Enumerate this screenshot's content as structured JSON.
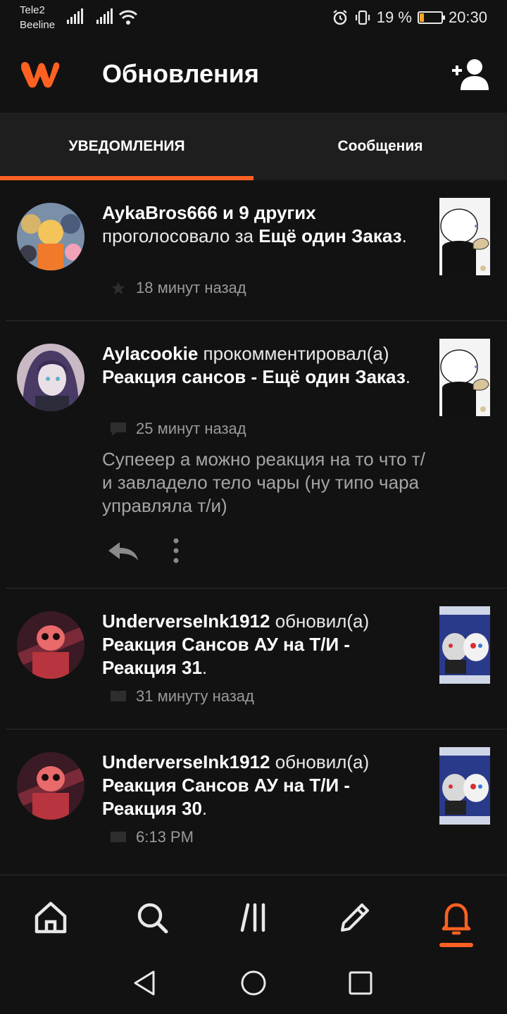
{
  "status_bar": {
    "carrier_1": "Tele2",
    "carrier_2": "Beeline",
    "battery": "19 %",
    "time": "20:30",
    "battery_level": 0.19
  },
  "header": {
    "title": "Обновления"
  },
  "tabs": [
    {
      "label": "УВЕДОМЛЕНИЯ",
      "active": true
    },
    {
      "label": "Сообщения",
      "active": false
    }
  ],
  "notifications": [
    {
      "user": "AykaBros666 и 9 других",
      "action": " проголосовало за ",
      "story": "Ещё один Заказ",
      "end": ".",
      "meta_icon": "star-icon",
      "time": "18 минут назад"
    },
    {
      "user": "Aylacookie",
      "action": " прокомментировал(а) ",
      "story": "Реакция сансов - Ещё один Заказ",
      "end": ".",
      "meta_icon": "comment-icon",
      "time": "25 минут назад",
      "comment": "Супееер а можно реакция на то что т/и завладело тело чары (ну типо чара управляла т/и)"
    },
    {
      "user": "UnderverseInk1912",
      "action": " обновил(а) ",
      "story": "Реакция Сансов АУ на Т/И - Реакция 31",
      "end": ".",
      "meta_icon": "book-icon",
      "time": "31 минуту назад"
    },
    {
      "user": "UnderverseInk1912",
      "action": " обновил(а) ",
      "story": "Реакция Сансов АУ на Т/И - Реакция 30",
      "end": ".",
      "meta_icon": "book-icon",
      "time": "6:13 PM"
    }
  ],
  "bottom_nav": [
    {
      "icon": "home-icon",
      "active": false
    },
    {
      "icon": "search-icon",
      "active": false
    },
    {
      "icon": "library-icon",
      "active": false
    },
    {
      "icon": "pencil-icon",
      "active": false
    },
    {
      "icon": "bell-icon",
      "active": true
    }
  ],
  "colors": {
    "accent": "#ff6122",
    "background": "#121212",
    "tab_bar": "#1e1e1e"
  }
}
